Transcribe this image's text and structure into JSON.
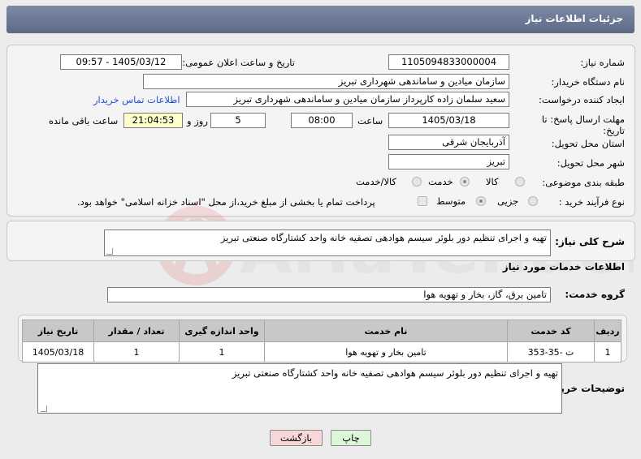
{
  "header": {
    "title": "جزئیات اطلاعات نیاز"
  },
  "form": {
    "need_number_label": "شماره نیاز:",
    "need_number": "1105094833000004",
    "announce_label": "تاریخ و ساعت اعلان عمومی:",
    "announce_value": "1405/03/12 - 09:57",
    "buyer_org_label": "نام دستگاه خریدار:",
    "buyer_org": "سازمان میادین و ساماندهی شهرداری تبریز",
    "creator_label": "ایجاد کننده درخواست:",
    "creator": "سعید سلمان زاده کارپرداز سازمان میادین و ساماندهی شهرداری تبریز",
    "contact_link": "اطلاعات تماس خریدار",
    "deadline_label": "مهلت ارسال پاسخ: تا تاریخ:",
    "deadline_date": "1405/03/18",
    "time_label": "ساعت",
    "deadline_time": "08:00",
    "days_value": "5",
    "days_label": "روز و",
    "remaining_time": "21:04:53",
    "remaining_label": "ساعت باقی مانده",
    "province_label": "استان محل تحویل:",
    "province": "آذربایجان شرقی",
    "city_label": "شهر محل تحویل:",
    "city": "تبریز",
    "category_label": "طبقه بندی موضوعی:",
    "category_options": [
      "کالا",
      "خدمت",
      "کالا/خدمت"
    ],
    "category_selected": "خدمت",
    "process_label": "نوع فرآیند خرید :",
    "process_options": [
      "جزیی",
      "متوسط"
    ],
    "process_selected": "متوسط",
    "payment_note": "پرداخت تمام یا بخشی از مبلغ خرید،از محل \"اسناد خزانه اسلامی\" خواهد بود."
  },
  "summary": {
    "label": "شرح کلی نیاز:",
    "text": "تهیه و اجرای تنظیم دور بلوئر سیسم هوادهی تصفیه خانه واحد کشتارگاه صنعتی تبریز"
  },
  "services": {
    "section_title": "اطلاعات خدمات مورد نیاز",
    "group_label": "گروه خدمت:",
    "group_value": "تامین برق، گاز، بخار و تهویه هوا",
    "table": {
      "headers": [
        "ردیف",
        "کد خدمت",
        "نام خدمت",
        "واحد اندازه گیری",
        "تعداد / مقدار",
        "تاریخ نیاز"
      ],
      "rows": [
        [
          "1",
          "ت -35-353",
          "تامین بخار و تهویه هوا",
          "1",
          "1",
          "1405/03/18"
        ]
      ]
    }
  },
  "buyer_notes": {
    "label": "توضیحات خریدار:",
    "text": "تهیه و اجرای تنظیم دور بلوئر سیسم هوادهی تصفیه خانه واحد کشتارگاه صنعتی تبریز"
  },
  "buttons": {
    "print": "چاپ",
    "back": "بازگشت"
  },
  "watermark_text": "AriaTender.net",
  "colors": {
    "header": "#6b7894",
    "link": "#1f4fd8",
    "back_button": "#f7d7d7",
    "print_button": "#ddf5d9",
    "highlight": "#ffffcc"
  }
}
